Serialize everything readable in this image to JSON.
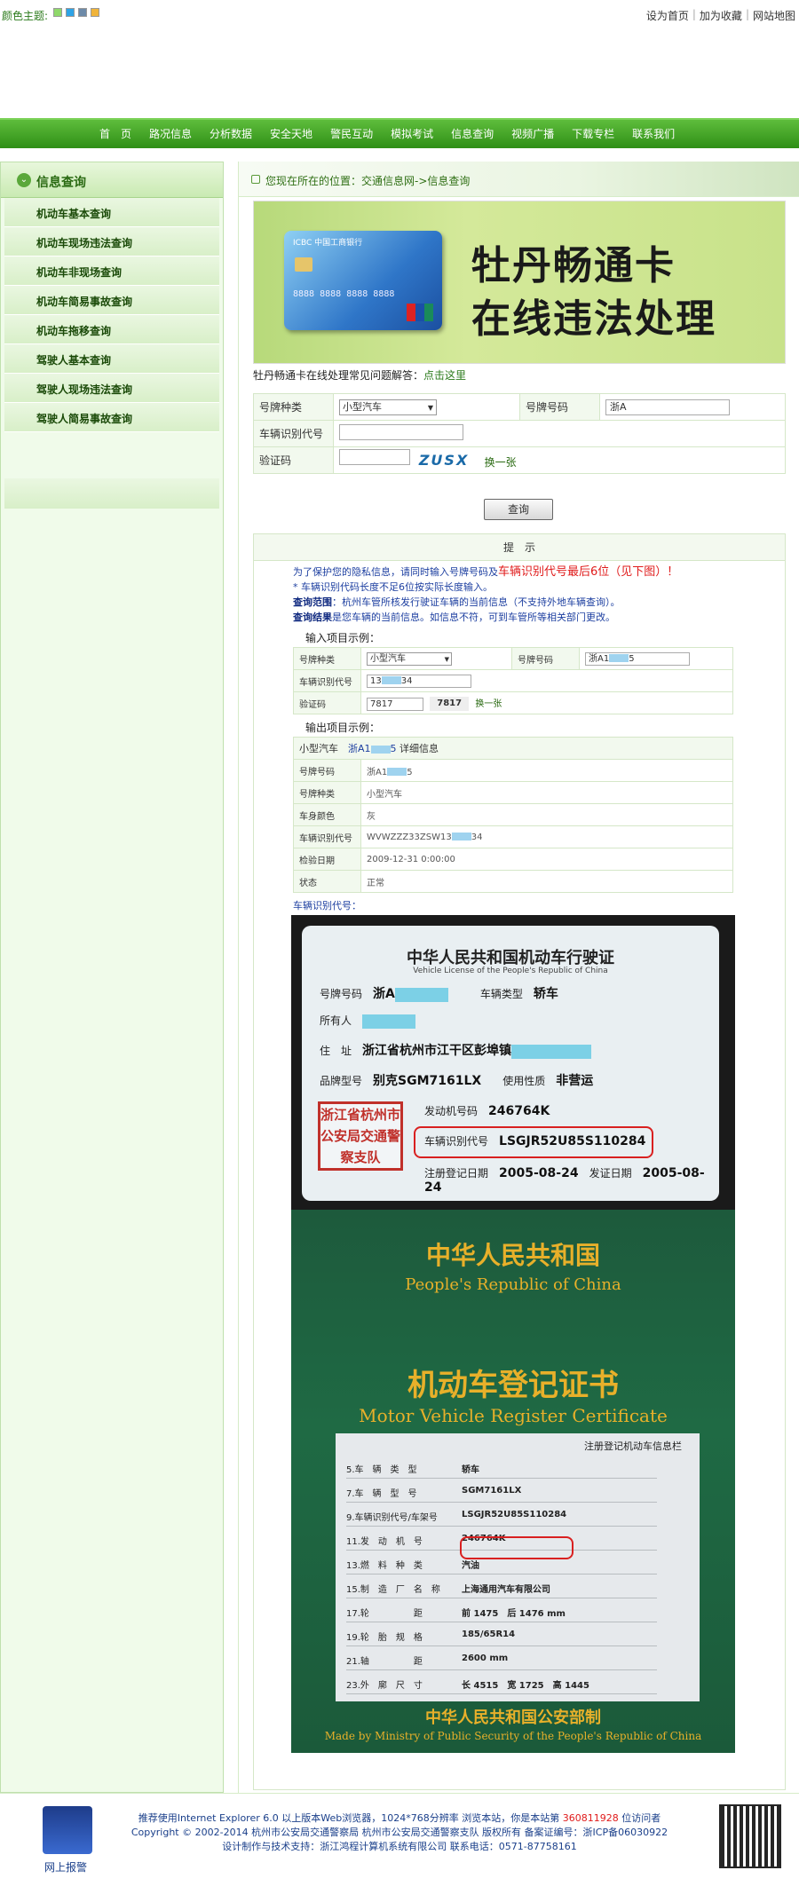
{
  "topbar": {
    "theme_label": "颜色主题:",
    "swatches": [
      "#8fd86a",
      "#2ea3e6",
      "#6d8aa8",
      "#f0b43a"
    ],
    "links": [
      "设为首页",
      "加为收藏",
      "网站地图"
    ]
  },
  "nav": {
    "items": [
      "首　页",
      "路况信息",
      "分析数据",
      "安全天地",
      "警民互动",
      "模拟考试",
      "信息查询",
      "视频广播",
      "下载专栏",
      "联系我们"
    ]
  },
  "sidebar": {
    "title": "信息查询",
    "items": [
      "机动车基本查询",
      "机动车现场违法查询",
      "机动车非现场查询",
      "机动车简易事故查询",
      "机动车拖移查询",
      "驾驶人基本查询",
      "驾驶人现场违法查询",
      "驾驶人简易事故查询"
    ]
  },
  "breadcrumb": "您现在所在的位置：交通信息网->信息查询",
  "banner": {
    "bank_name": "ICBC 中国工商银行",
    "card_number": "8888 8888 8888 8888",
    "line1": "牡丹畅通卡",
    "line2": "在线违法处理"
  },
  "faq": {
    "text": "牡丹畅通卡在线处理常见问题解答：",
    "link": "点击这里"
  },
  "form": {
    "plate_type_label": "号牌种类",
    "plate_type_value": "小型汽车",
    "plate_no_label": "号牌号码",
    "plate_no_value": "浙A",
    "vin_label": "车辆识别代号",
    "captcha_label": "验证码",
    "captcha_text": "ZUSX",
    "refresh": "换一张",
    "submit": "查询"
  },
  "tip": {
    "heading": "提　示",
    "line1_a": "为了保护您的隐私信息，请同时输入号牌号码及",
    "line1_b": "车辆识别代号最后6位（见下图）",
    "line1_c": "！",
    "line2": "* 车辆识别代码长度不足6位按实际长度输入。",
    "line3_k": "查询范围",
    "line3_v": "：杭州车管所核发行驶证车辆的当前信息（不支持外地车辆查询）。",
    "line4_k": "查询结果",
    "line4_v": "是您车辆的当前信息。如信息不符，可到车管所等相关部门更改。",
    "input_example_title": "输入项目示例：",
    "ex_plate_type_label": "号牌种类",
    "ex_plate_type_value": "小型汽车",
    "ex_plate_no_label": "号牌号码",
    "ex_plate_no_value_a": "浙A1",
    "ex_plate_no_value_b": "5",
    "ex_vin_label": "车辆识别代号",
    "ex_vin_value_a": "13",
    "ex_vin_value_b": "34",
    "ex_captcha_label": "验证码",
    "ex_captcha_value": "7817",
    "ex_captcha_img": "7817",
    "ex_refresh": "换一张",
    "output_example_title": "输出项目示例：",
    "out_head_a": "小型汽车",
    "out_head_plate_a": "浙A1",
    "out_head_plate_b": "5",
    "out_head_c": "详细信息",
    "out_rows": [
      {
        "k": "号牌号码",
        "v": "浙A1",
        "v2": "5"
      },
      {
        "k": "号牌种类",
        "v": "小型汽车"
      },
      {
        "k": "车身颜色",
        "v": "灰"
      },
      {
        "k": "车辆识别代号",
        "v": "WVWZZZ33ZSW13",
        "v2": "34"
      },
      {
        "k": "检验日期",
        "v": "2009-12-31 0:00:00"
      },
      {
        "k": "状态",
        "v": "正常"
      }
    ],
    "vin_caption": "车辆识别代号："
  },
  "license": {
    "title": "中华人民共和国机动车行驶证",
    "subtitle": "Vehicle License of the People's Republic of China",
    "plate_label": "号牌号码",
    "plate_value": "浙A",
    "vtype_label": "车辆类型",
    "vtype_value": "轿车",
    "owner_label": "所有人",
    "address_label": "住　址",
    "address_value": "浙江省杭州市江干区彭埠镇",
    "model_label": "品牌型号",
    "model_value": "别克SGM7161LX",
    "use_label": "使用性质",
    "use_value": "非营运",
    "engine_label": "发动机号码",
    "engine_value": "246764K",
    "vin_label": "车辆识别代号",
    "vin_value": "LSGJR52U85S110284",
    "reg_date_label": "注册登记日期",
    "reg_date": "2005-08-24",
    "issue_label": "发证日期",
    "issue_date": "2005-08-24",
    "stamp": "浙江省杭州市公安局交通警察支队"
  },
  "cert": {
    "t1": "中华人民共和国",
    "t2": "People's Republic of China",
    "t3": "机动车登记证书",
    "t4": "Motor Vehicle Register Certificate",
    "inner_title": "注册登记机动车信息栏",
    "rows": [
      {
        "k": "5.车　辆　类　型",
        "v": "轿车"
      },
      {
        "k": "7.车　辆　型　号",
        "v": "SGM7161LX"
      },
      {
        "k": "9.车辆识别代号/车架号",
        "v": "LSGJR52U85S110284"
      },
      {
        "k": "11.发　动　机　号",
        "v": "246764K"
      },
      {
        "k": "13.燃　料　种　类",
        "v": "汽油"
      },
      {
        "k": "15.制　造　厂　名　称",
        "v": "上海通用汽车有限公司"
      },
      {
        "k": "17.轮　　　　　距",
        "v": "前 1475　后 1476 mm"
      },
      {
        "k": "19.轮　胎　规　格",
        "v": "185/65R14"
      },
      {
        "k": "21.轴　　　　　距",
        "v": "2600 mm"
      },
      {
        "k": "23.外　廓　尺　寸",
        "v": "长 4515　宽 1725　高 1445"
      }
    ],
    "t5": "中华人民共和国公安部制",
    "t6": "Made by Ministry of Public Security of the People's Republic of China"
  },
  "footer": {
    "police_label": "网上报警",
    "line1_a": "推荐使用Internet Explorer 6.0 以上版本Web浏览器，1024*768分辨率 浏览本站，你是本站第",
    "counter": "360811928",
    "line1_b": "位访问者",
    "line2": "Copyright © 2002-2014 杭州市公安局交通警察局 杭州市公安局交通警察支队 版权所有 备案证编号：浙ICP备06030922",
    "line3": "设计制作与技术支持：浙江鸿程计算机系统有限公司 联系电话：0571-87758161"
  }
}
